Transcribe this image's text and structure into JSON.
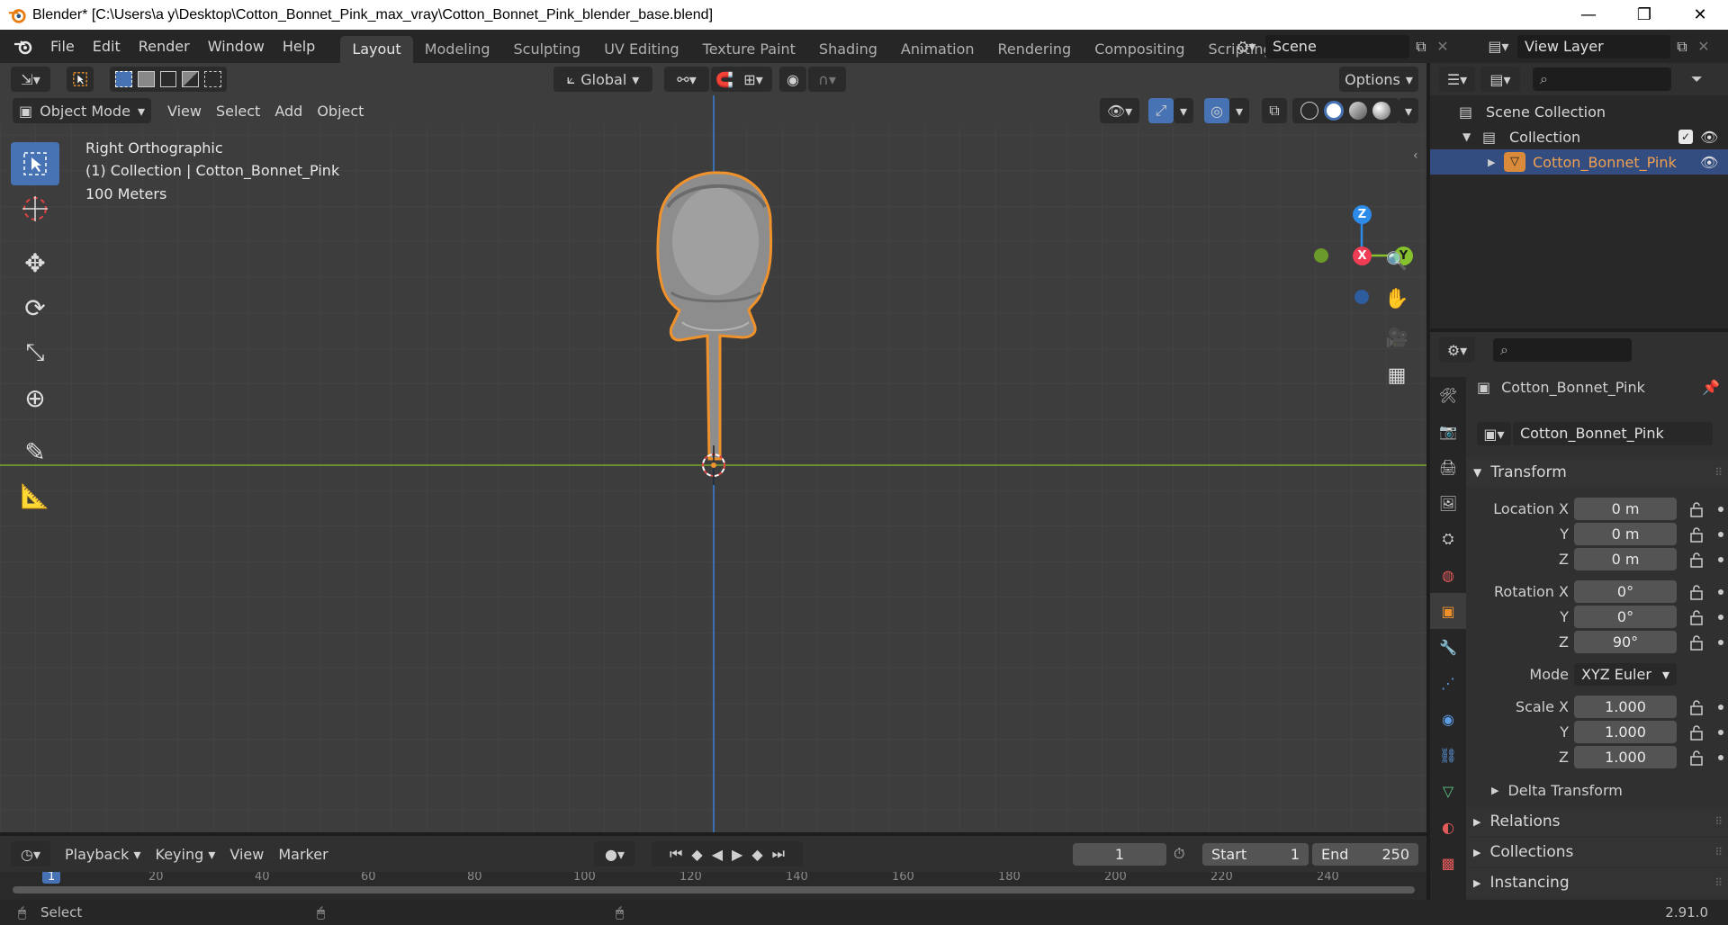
{
  "window": {
    "title": "Blender* [C:\\Users\\a y\\Desktop\\Cotton_Bonnet_Pink_max_vray\\Cotton_Bonnet_Pink_blender_base.blend]",
    "minimize": "—",
    "maximize": "❐",
    "close": "✕"
  },
  "menu": [
    "File",
    "Edit",
    "Render",
    "Window",
    "Help"
  ],
  "workspaces": [
    "Layout",
    "Modeling",
    "Sculpting",
    "UV Editing",
    "Texture Paint",
    "Shading",
    "Animation",
    "Rendering",
    "Compositing",
    "Scripting"
  ],
  "active_workspace": "Layout",
  "scene": {
    "name": "Scene",
    "view_layer": "View Layer"
  },
  "viewport": {
    "orientation": "Global",
    "options_label": "Options",
    "mode": "Object Mode",
    "menus": [
      "View",
      "Select",
      "Add",
      "Object"
    ],
    "view_name": "Right Orthographic",
    "collection_info": "(1) Collection | Cotton_Bonnet_Pink",
    "scale_info": "100 Meters",
    "gizmo": {
      "z": "Z",
      "x": "X",
      "y": "Y"
    }
  },
  "outliner": {
    "scene_collection": "Scene Collection",
    "collection": "Collection",
    "object": "Cotton_Bonnet_Pink"
  },
  "properties": {
    "object_name": "Cotton_Bonnet_Pink",
    "data_name": "Cotton_Bonnet_Pink",
    "transform_title": "Transform",
    "location": {
      "label_x": "Location X",
      "label_y": "Y",
      "label_z": "Z",
      "x": "0 m",
      "y": "0 m",
      "z": "0 m"
    },
    "rotation": {
      "label_x": "Rotation X",
      "label_y": "Y",
      "label_z": "Z",
      "x": "0°",
      "y": "0°",
      "z": "90°"
    },
    "mode_label": "Mode",
    "mode_value": "XYZ Euler",
    "scale": {
      "label_x": "Scale X",
      "label_y": "Y",
      "label_z": "Z",
      "x": "1.000",
      "y": "1.000",
      "z": "1.000"
    },
    "delta_transform": "Delta Transform",
    "relations": "Relations",
    "collections": "Collections",
    "instancing": "Instancing"
  },
  "timeline": {
    "menus": [
      "Playback",
      "Keying",
      "View",
      "Marker"
    ],
    "current_frame": "1",
    "start_label": "Start",
    "start": "1",
    "end_label": "End",
    "end": "250",
    "ruler_ticks": [
      "1",
      "20",
      "40",
      "60",
      "80",
      "100",
      "120",
      "140",
      "160",
      "180",
      "200",
      "220",
      "240"
    ]
  },
  "status": {
    "left": "Select",
    "version": "2.91.0"
  },
  "colors": {
    "accent": "#4772b3",
    "selection": "#f0922b",
    "x_axis": "#ee3d55",
    "y_axis": "#87c22c",
    "z_axis": "#2c8ae8"
  }
}
